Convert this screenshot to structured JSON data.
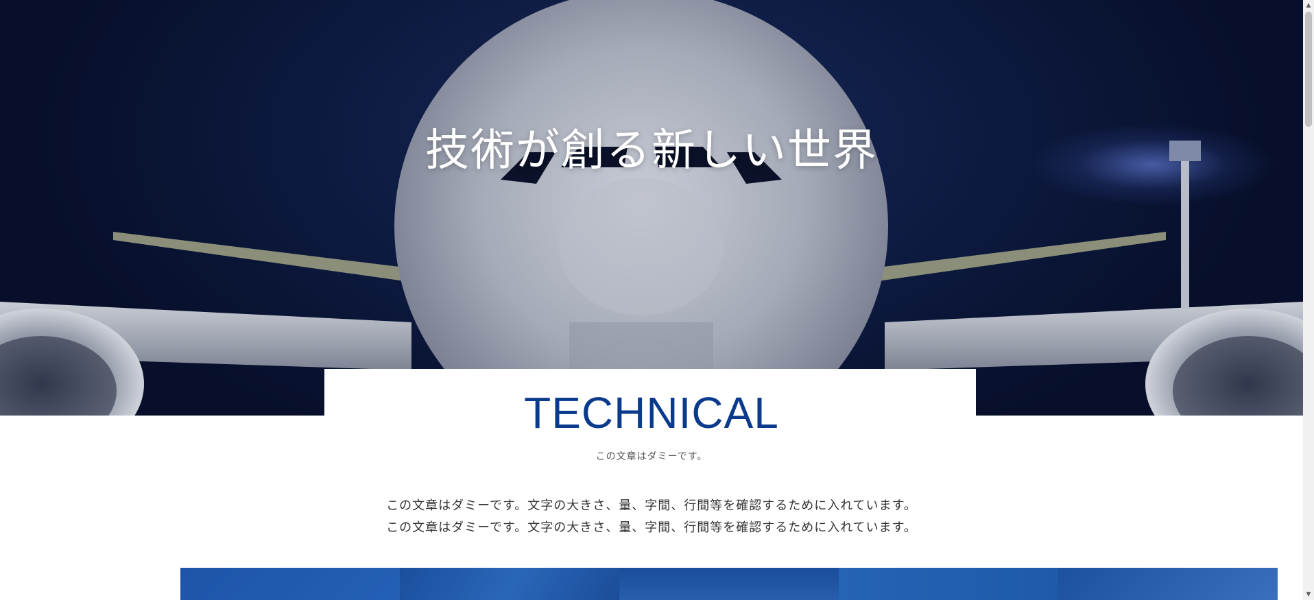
{
  "hero": {
    "title": "技術が創る新しい世界"
  },
  "section": {
    "title": "TECHNICAL",
    "subtitle": "この文章はダミーです。",
    "paragraph_lines": [
      "この文章はダミーです。文字の大きさ、量、字間、行間等を確認するために入れています。",
      "この文章はダミーです。文字の大きさ、量、字間、行間等を確認するために入れています。"
    ]
  },
  "colors": {
    "accent": "#0a3a8c",
    "strip_blue": "#1f56a6",
    "hero_sky": "#0d1a3f"
  },
  "scrollbar": {
    "up_icon": "scroll-up-arrow-icon",
    "down_icon": "scroll-down-arrow-icon"
  }
}
